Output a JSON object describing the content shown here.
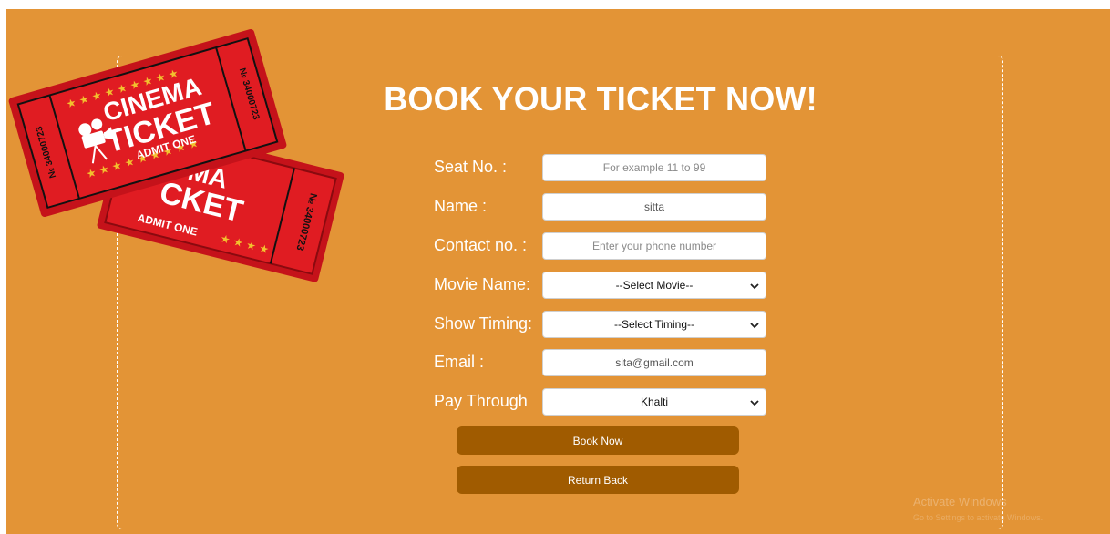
{
  "form": {
    "title": "BOOK YOUR TICKET NOW!",
    "seat": {
      "label": "Seat No. :",
      "placeholder": "For example 11 to 99",
      "value": ""
    },
    "name": {
      "label": "Name :",
      "placeholder": "",
      "value": "sitta"
    },
    "contact": {
      "label": "Contact no. :",
      "placeholder": "Enter your phone number",
      "value": ""
    },
    "movie": {
      "label": "Movie Name:",
      "selected": "--Select Movie--"
    },
    "timing": {
      "label": "Show Timing:",
      "selected": "--Select Timing--"
    },
    "email": {
      "label": "Email :",
      "placeholder": "",
      "value": "sita@gmail.com"
    },
    "pay": {
      "label": "Pay Through",
      "selected": "Khalti"
    },
    "book_label": "Book Now",
    "return_label": "Return Back"
  },
  "ticket_graphic": {
    "front_line1": "CINEMA",
    "front_line2": "TICKET",
    "front_admit": "ADMIT ONE",
    "back_line1": "MA",
    "back_line2": "CKET",
    "back_admit": "ADMIT ONE",
    "serial": "№ 34000723",
    "icon": "film-camera-icon"
  },
  "watermark": {
    "line1": "Activate Windows",
    "line2": "Go to Settings to activate Windows."
  },
  "colors": {
    "background": "#e39436",
    "button": "#a05b00",
    "ticket_red": "#d8161c",
    "star": "#f2c12e"
  }
}
